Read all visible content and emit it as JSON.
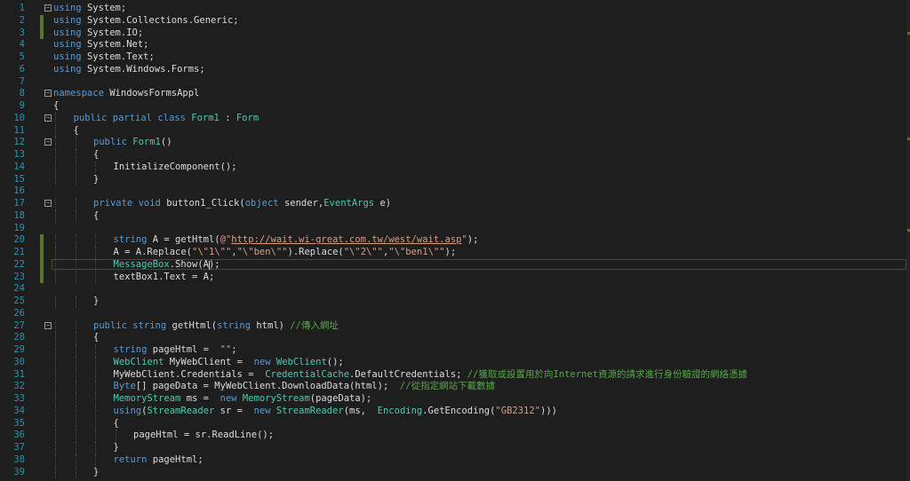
{
  "editor": {
    "lines": [
      {
        "n": "1",
        "fold": "-",
        "changed": false,
        "indent": 0,
        "parts": [
          [
            "kw",
            "using"
          ],
          [
            "",
            "System;"
          ]
        ]
      },
      {
        "n": "2",
        "fold": "",
        "changed": true,
        "indent": 0,
        "parts": [
          [
            "kw",
            "using"
          ],
          [
            "",
            "System.Collections.Generic;"
          ]
        ]
      },
      {
        "n": "3",
        "fold": "",
        "changed": true,
        "indent": 0,
        "parts": [
          [
            "kw",
            "using"
          ],
          [
            "",
            "System.IO;"
          ]
        ]
      },
      {
        "n": "4",
        "fold": "",
        "changed": false,
        "indent": 0,
        "parts": [
          [
            "kw",
            "using"
          ],
          [
            "",
            "System.Net;"
          ]
        ]
      },
      {
        "n": "5",
        "fold": "",
        "changed": false,
        "indent": 0,
        "parts": [
          [
            "kw",
            "using"
          ],
          [
            "",
            "System.Text;"
          ]
        ]
      },
      {
        "n": "6",
        "fold": "",
        "changed": false,
        "indent": 0,
        "parts": [
          [
            "kw",
            "using"
          ],
          [
            "",
            "System.Windows.Forms;"
          ]
        ]
      },
      {
        "n": "7",
        "fold": "",
        "changed": false,
        "indent": 0,
        "parts": []
      },
      {
        "n": "8",
        "fold": "-",
        "changed": false,
        "indent": 0,
        "parts": [
          [
            "kw",
            "namespace"
          ],
          [
            "",
            "WindowsFormsAppl"
          ]
        ]
      },
      {
        "n": "9",
        "fold": "",
        "changed": false,
        "indent": 0,
        "parts": [
          [
            "",
            "{"
          ]
        ]
      },
      {
        "n": "10",
        "fold": "-",
        "changed": false,
        "indent": 1,
        "parts": [
          [
            "kw",
            "public partial class"
          ],
          [
            "ty",
            "Form1"
          ],
          [
            "",
            ":"
          ],
          [
            "ty",
            "Form"
          ]
        ]
      },
      {
        "n": "11",
        "fold": "",
        "changed": false,
        "indent": 1,
        "parts": [
          [
            "",
            "{"
          ]
        ]
      },
      {
        "n": "12",
        "fold": "-",
        "changed": false,
        "indent": 2,
        "parts": [
          [
            "kw",
            "public"
          ],
          [
            "ty",
            "Form1"
          ],
          [
            "",
            "()"
          ]
        ]
      },
      {
        "n": "13",
        "fold": "",
        "changed": false,
        "indent": 2,
        "parts": [
          [
            "",
            "{"
          ]
        ]
      },
      {
        "n": "14",
        "fold": "",
        "changed": false,
        "indent": 3,
        "parts": [
          [
            "",
            "InitializeComponent();"
          ]
        ]
      },
      {
        "n": "15",
        "fold": "",
        "changed": false,
        "indent": 2,
        "parts": [
          [
            "",
            "}"
          ]
        ]
      },
      {
        "n": "16",
        "fold": "",
        "changed": false,
        "indent": 0,
        "parts": []
      },
      {
        "n": "17",
        "fold": "-",
        "changed": false,
        "indent": 2,
        "parts": [
          [
            "kw",
            "private void"
          ],
          [
            "",
            "button1_Click("
          ],
          [
            "kw",
            "object"
          ],
          [
            "",
            "sender,"
          ],
          [
            "ty",
            "EventArgs"
          ],
          [
            "",
            "e)"
          ]
        ]
      },
      {
        "n": "18",
        "fold": "",
        "changed": false,
        "indent": 2,
        "parts": [
          [
            "",
            "{"
          ]
        ]
      },
      {
        "n": "19",
        "fold": "",
        "changed": false,
        "indent": 0,
        "parts": []
      },
      {
        "n": "20",
        "fold": "",
        "changed": true,
        "indent": 3,
        "parts": [
          [
            "kw",
            "string"
          ],
          [
            "",
            "A = getHtml("
          ],
          [
            "str",
            "@\""
          ],
          [
            "url",
            "http://wait.wi-great.com.tw/west/wait.asp"
          ],
          [
            "str",
            "\""
          ],
          [
            "",
            ");"
          ]
        ]
      },
      {
        "n": "21",
        "fold": "",
        "changed": true,
        "indent": 3,
        "parts": [
          [
            "",
            "A = A.Replace("
          ],
          [
            "str",
            "\"\\\"1\\\"\""
          ],
          [
            "",
            ","
          ],
          [
            "str",
            "\"\\\"ben\\\"\""
          ],
          [
            "",
            ").Replace("
          ],
          [
            "str",
            "\"\\\"2\\\"\""
          ],
          [
            "",
            ","
          ],
          [
            "str",
            "\"\\\"ben1\\\"\""
          ],
          [
            "",
            ");"
          ]
        ]
      },
      {
        "n": "22",
        "fold": "",
        "changed": true,
        "indent": 3,
        "parts": [
          [
            "ty",
            "MessageBox"
          ],
          [
            "",
            ".Show(A);"
          ]
        ]
      },
      {
        "n": "23",
        "fold": "",
        "changed": true,
        "indent": 3,
        "parts": [
          [
            "",
            "textBox1.Text = A;"
          ]
        ]
      },
      {
        "n": "24",
        "fold": "",
        "changed": false,
        "indent": 0,
        "parts": []
      },
      {
        "n": "25",
        "fold": "",
        "changed": false,
        "indent": 2,
        "parts": [
          [
            "",
            "}"
          ]
        ]
      },
      {
        "n": "26",
        "fold": "",
        "changed": false,
        "indent": 0,
        "parts": []
      },
      {
        "n": "27",
        "fold": "-",
        "changed": false,
        "indent": 2,
        "parts": [
          [
            "kw",
            "public string"
          ],
          [
            "",
            "getHtml("
          ],
          [
            "kw",
            "string"
          ],
          [
            "",
            "html)"
          ],
          [
            "cm",
            "//傳入網址"
          ]
        ]
      },
      {
        "n": "28",
        "fold": "",
        "changed": false,
        "indent": 2,
        "parts": [
          [
            "",
            "{"
          ]
        ]
      },
      {
        "n": "29",
        "fold": "",
        "changed": false,
        "indent": 3,
        "parts": [
          [
            "kw",
            "string"
          ],
          [
            "",
            "pageHtml = "
          ],
          [
            "str",
            "\"\""
          ],
          [
            "",
            ";"
          ]
        ]
      },
      {
        "n": "30",
        "fold": "",
        "changed": false,
        "indent": 3,
        "parts": [
          [
            "ty",
            "WebClient"
          ],
          [
            "",
            "MyWebClient = "
          ],
          [
            "kw",
            "new"
          ],
          [
            "ty",
            "WebClient"
          ],
          [
            "",
            "();"
          ]
        ]
      },
      {
        "n": "31",
        "fold": "",
        "changed": false,
        "indent": 3,
        "parts": [
          [
            "",
            "MyWebClient.Credentials = "
          ],
          [
            "ty",
            "CredentialCache"
          ],
          [
            "",
            ".DefaultCredentials;"
          ],
          [
            "cm",
            "//獲取或設置用於向Internet資源的請求進行身份驗證的網絡憑據"
          ]
        ]
      },
      {
        "n": "32",
        "fold": "",
        "changed": false,
        "indent": 3,
        "parts": [
          [
            "kw",
            "Byte"
          ],
          [
            "",
            "[] pageData = MyWebClient.DownloadData(html); "
          ],
          [
            "cm",
            "//從指定網站下載數據"
          ]
        ]
      },
      {
        "n": "33",
        "fold": "",
        "changed": false,
        "indent": 3,
        "parts": [
          [
            "ty",
            "MemoryStream"
          ],
          [
            "",
            "ms = "
          ],
          [
            "kw",
            "new"
          ],
          [
            "ty",
            "MemoryStream"
          ],
          [
            "",
            "(pageData);"
          ]
        ]
      },
      {
        "n": "34",
        "fold": "",
        "changed": false,
        "indent": 3,
        "parts": [
          [
            "kw",
            "using"
          ],
          [
            "",
            "("
          ],
          [
            "ty",
            "StreamReader"
          ],
          [
            "",
            "sr = "
          ],
          [
            "kw",
            "new"
          ],
          [
            "ty",
            "StreamReader"
          ],
          [
            "",
            "(ms, "
          ],
          [
            "ty",
            "Encoding"
          ],
          [
            "",
            ".GetEncoding("
          ],
          [
            "str",
            "\"GB2312\""
          ],
          [
            "",
            "))) "
          ]
        ]
      },
      {
        "n": "35",
        "fold": "",
        "changed": false,
        "indent": 3,
        "parts": [
          [
            "",
            "{"
          ]
        ]
      },
      {
        "n": "36",
        "fold": "",
        "changed": false,
        "indent": 4,
        "parts": [
          [
            "",
            "pageHtml = sr.ReadLine();"
          ]
        ]
      },
      {
        "n": "37",
        "fold": "",
        "changed": false,
        "indent": 3,
        "parts": [
          [
            "",
            "}"
          ]
        ]
      },
      {
        "n": "38",
        "fold": "",
        "changed": false,
        "indent": 3,
        "parts": [
          [
            "kw",
            "return"
          ],
          [
            "",
            "pageHtml;"
          ]
        ]
      },
      {
        "n": "39",
        "fold": "",
        "changed": false,
        "indent": 2,
        "parts": [
          [
            "",
            "}"
          ]
        ]
      }
    ],
    "current_line": "22"
  }
}
